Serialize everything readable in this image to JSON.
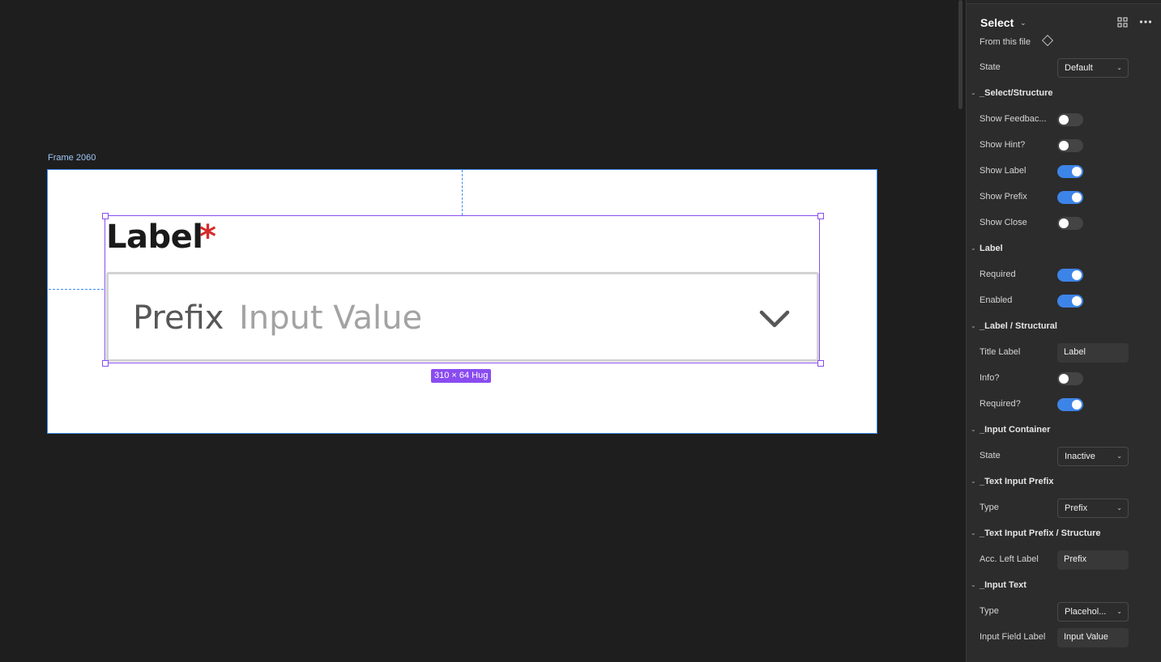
{
  "canvas": {
    "frame_title": "Frame 2060",
    "label_text": "Label",
    "required_mark": "*",
    "prefix_text": "Prefix",
    "placeholder_text": "Input Value",
    "size_badge": "310 × 64 Hug",
    "colors": {
      "selection": "#8a4cf0",
      "frame_border": "#3c8bef",
      "required": "#d62b2b"
    }
  },
  "panel": {
    "component_name": "Select",
    "source": "From this file",
    "rows": [
      {
        "type": "dropdown",
        "label": "State",
        "value": "Default"
      },
      {
        "type": "section",
        "label": "_Select/Structure"
      },
      {
        "type": "toggle",
        "label": "Show Feedbac...",
        "on": false
      },
      {
        "type": "toggle",
        "label": "Show Hint?",
        "on": false
      },
      {
        "type": "toggle",
        "label": "Show Label",
        "on": true
      },
      {
        "type": "toggle",
        "label": "Show Prefix",
        "on": true
      },
      {
        "type": "toggle",
        "label": "Show Close",
        "on": false
      },
      {
        "type": "section",
        "label": "Label"
      },
      {
        "type": "toggle",
        "label": "Required",
        "on": true
      },
      {
        "type": "toggle",
        "label": "Enabled",
        "on": true
      },
      {
        "type": "section",
        "label": "_Label / Structural"
      },
      {
        "type": "text",
        "label": "Title Label",
        "value": "Label"
      },
      {
        "type": "toggle",
        "label": "Info?",
        "on": false
      },
      {
        "type": "toggle",
        "label": "Required?",
        "on": true
      },
      {
        "type": "section",
        "label": "_Input Container"
      },
      {
        "type": "dropdown",
        "label": "State",
        "value": "Inactive"
      },
      {
        "type": "section",
        "label": "_Text Input Prefix"
      },
      {
        "type": "dropdown",
        "label": "Type",
        "value": "Prefix"
      },
      {
        "type": "section",
        "label": "_Text Input Prefix / Structure"
      },
      {
        "type": "text",
        "label": "Acc. Left Label",
        "value": "Prefix"
      },
      {
        "type": "section",
        "label": "_Input Text"
      },
      {
        "type": "dropdown",
        "label": "Type",
        "value": "Placehol..."
      },
      {
        "type": "text",
        "label": "Input Field Label",
        "value": "Input Value"
      }
    ]
  }
}
